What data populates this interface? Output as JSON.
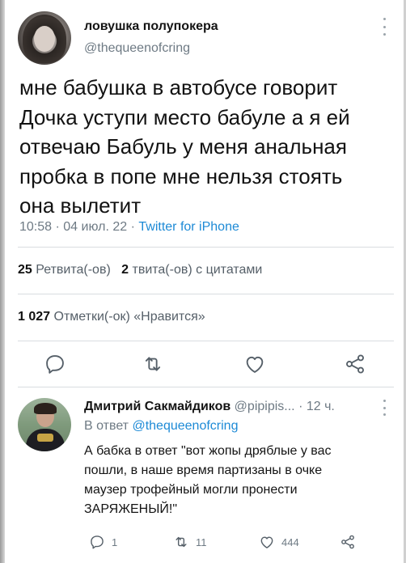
{
  "main_tweet": {
    "display_name": "ловушка полупокера",
    "handle": "@thequeenofcring",
    "text_lines": [
      "мне бабушка в автобусе говорит",
      "Дочка уступи место бабуле а я ей",
      "отвечаю Бабуль у меня анальная",
      "пробка в попе мне нельзя стоять",
      "она вылетит"
    ],
    "time": "10:58",
    "date": "04 июл. 22",
    "separator": "·",
    "source": "Twitter for iPhone",
    "retweets_count": "25",
    "retweets_label": "Ретвита(-ов)",
    "quotes_count": "2",
    "quotes_label": "твита(-ов) с цитатами",
    "likes_count": "1 027",
    "likes_label": "Отметки(-ок) «Нравится»",
    "actions": [
      "reply-icon",
      "retweet-icon",
      "like-icon",
      "share-icon"
    ]
  },
  "reply_tweet": {
    "display_name": "Дмитрий Сакмайдиков",
    "handle": "@pipipis...",
    "separator": "·",
    "time": "12 ч.",
    "reply_prefix": "В ответ",
    "reply_mention": "@thequeenofcring",
    "text_lines": [
      "А бабка в ответ \"вот жопы дряблые у вас",
      "пошли, в наше время партизаны в очке",
      "маузер трофейный могли пронести",
      "ЗАРЯЖЕНЫЙ!\""
    ],
    "reply_count": "1",
    "retweet_count": "11",
    "like_count": "444"
  },
  "colors": {
    "text": "#121212",
    "secondary": "#6e7a84",
    "link": "#1d8ad6",
    "icon": "#555f68",
    "divider": "#d9dde0"
  }
}
